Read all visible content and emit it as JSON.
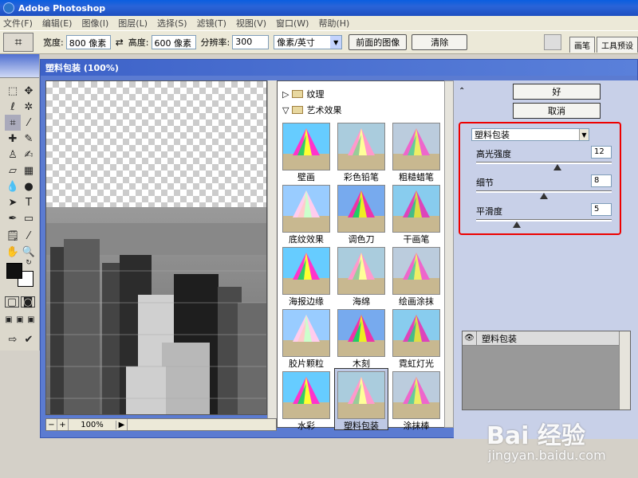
{
  "window": {
    "title": "Adobe Photoshop"
  },
  "menu": [
    "文件(F)",
    "编辑(E)",
    "图像(I)",
    "图层(L)",
    "选择(S)",
    "滤镜(T)",
    "视图(V)",
    "窗口(W)",
    "帮助(H)"
  ],
  "options": {
    "width_label": "宽度:",
    "width_value": "800 像素",
    "height_label": "高度:",
    "height_value": "600 像素",
    "res_label": "分辨率:",
    "res_value": "300",
    "unit": "像素/英寸",
    "front_image_label": "前面的图像",
    "clear_label": "清除"
  },
  "palette_tabs": [
    "画笔",
    "工具预设"
  ],
  "dialog": {
    "title": "塑料包装 (100%)",
    "zoom": "100%",
    "ok_label": "好",
    "cancel_label": "取消"
  },
  "gallery": {
    "folder_texture": "纹理",
    "folder_artistic": "艺术效果",
    "thumbs": [
      "壁画",
      "彩色铅笔",
      "粗糙蜡笔",
      "底纹效果",
      "调色刀",
      "干画笔",
      "海报边缘",
      "海绵",
      "绘画涂抹",
      "胶片颗粒",
      "木刻",
      "霓虹灯光",
      "水彩",
      "塑料包装",
      "涂抹棒"
    ],
    "selected_index": 13
  },
  "filter": {
    "selected": "塑料包装",
    "params": [
      {
        "label": "高光强度",
        "value": "12",
        "fraction": 0.6
      },
      {
        "label": "细节",
        "value": "8",
        "fraction": 0.5
      },
      {
        "label": "平滑度",
        "value": "5",
        "fraction": 0.3
      }
    ]
  },
  "layers": {
    "row_label": "塑料包装"
  },
  "watermark": {
    "logo": "Bai 经验",
    "url": "jingyan.baidu.com"
  },
  "colors": {
    "accent": "#5b7bd1",
    "highlight": "#ee0000"
  }
}
